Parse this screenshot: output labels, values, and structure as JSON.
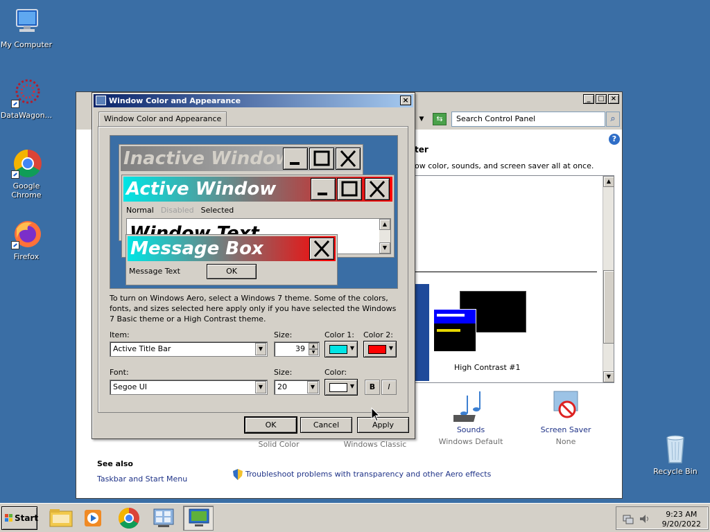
{
  "desktop": {
    "icons": [
      {
        "label": "My Computer"
      },
      {
        "label": "DataWagon..."
      },
      {
        "label": "Google Chrome"
      },
      {
        "label": "Firefox"
      },
      {
        "label": "Recycle Bin"
      }
    ]
  },
  "control_panel": {
    "search_placeholder": "Search Control Panel",
    "heading_fragment": "ter",
    "sub_fragment": "ow color, sounds, and screen saver all at once.",
    "theme_label": "High Contrast #1",
    "items": [
      {
        "title": "",
        "sub": "Solid Color"
      },
      {
        "title": "",
        "sub": "Windows Classic"
      },
      {
        "title": "Sounds",
        "sub": "Windows Default"
      },
      {
        "title": "Screen Saver",
        "sub": "None"
      }
    ],
    "see_also": "See also",
    "see_also_link": "Taskbar and Start Menu",
    "troubleshoot": "Troubleshoot problems with transparency and other Aero effects"
  },
  "dialog": {
    "title": "Window Color and Appearance",
    "tab": "Window Color and Appearance",
    "preview": {
      "inactive": "Inactive Window",
      "active": "Active Window",
      "menu_normal": "Normal",
      "menu_disabled": "Disabled",
      "menu_selected": "Selected",
      "window_text": "Window Text",
      "message_box": "Message Box",
      "message_text": "Message Text",
      "ok": "OK"
    },
    "description": "To turn on Windows Aero, select a Windows 7 theme.  Some of the colors, fonts, and sizes selected here apply only if you have selected the Windows 7 Basic theme or a High Contrast theme.",
    "item_label": "Item:",
    "item_value": "Active Title Bar",
    "size_label": "Size:",
    "item_size": "39",
    "color1_label": "Color 1:",
    "color2_label": "Color 2:",
    "color1": "#00e5e5",
    "color2": "#ff0000",
    "font_label": "Font:",
    "font_value": "Segoe UI",
    "font_size_label": "Size:",
    "font_size": "20",
    "font_color_label": "Color:",
    "font_color": "#ffffff",
    "bold": "B",
    "italic": "I",
    "ok": "OK",
    "cancel": "Cancel",
    "apply": "Apply"
  },
  "taskbar": {
    "start": "Start",
    "time": "9:23 AM",
    "date": "9/20/2022"
  }
}
